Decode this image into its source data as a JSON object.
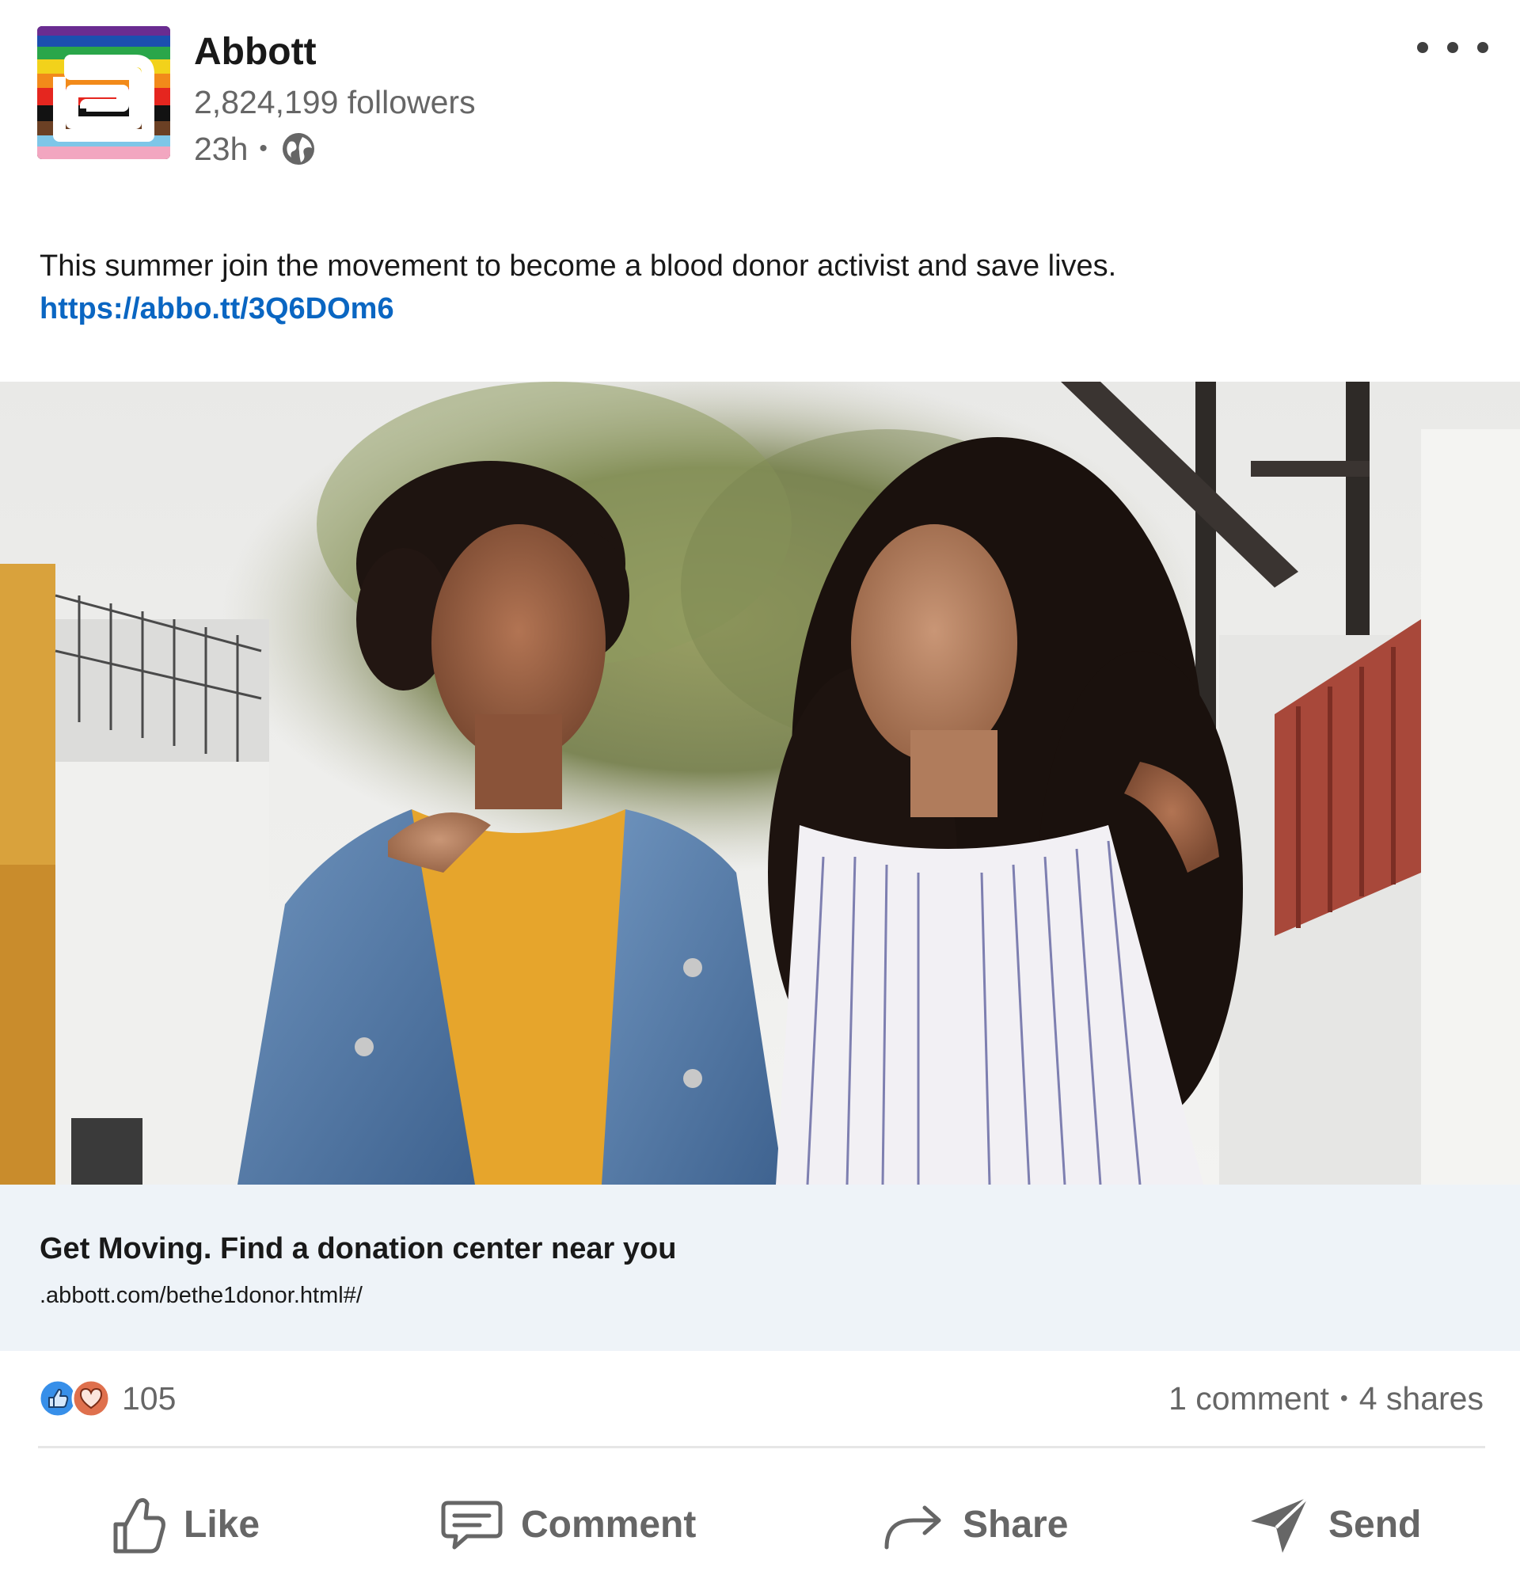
{
  "header": {
    "company_name": "Abbott",
    "followers": "2,824,199 followers",
    "time": "23h",
    "separator": "•",
    "visibility_icon": "globe-icon",
    "more_icon": "more-horizontal-icon"
  },
  "post": {
    "text": "This summer join the movement to become  a blood donor activist and save lives.",
    "link": "https://abbo.tt/3Q6DOm6"
  },
  "image": {
    "subject": "two young women walking arm in arm outdoors"
  },
  "link_preview": {
    "title": "Get Moving. Find a donation center near you",
    "url": ".abbott.com/bethe1donor.html#/"
  },
  "social": {
    "reaction_icons": [
      "like-reaction-icon",
      "love-reaction-icon"
    ],
    "reaction_count": "105",
    "comments": "1 comment",
    "separator": "•",
    "shares": "4 shares"
  },
  "actions": {
    "like": "Like",
    "comment": "Comment",
    "share": "Share",
    "send": "Send"
  },
  "colors": {
    "link": "#0a66c2",
    "preview_background": "#eef3f8",
    "muted_text": "#666666",
    "like_reaction": "#378fe9",
    "love_reaction": "#df704d"
  }
}
